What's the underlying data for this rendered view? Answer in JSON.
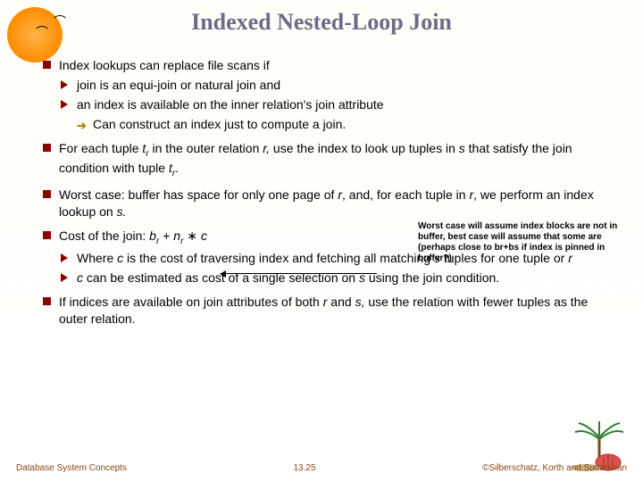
{
  "title": "Indexed Nested-Loop Join",
  "b1_1": "Index lookups can replace file scans if",
  "b2_1": "join is an equi-join or natural join and",
  "b2_2": "an index is available on the inner relation's join attribute",
  "b3_1": "Can construct an index just to compute a join.",
  "b1_2a": "For each tuple ",
  "b1_2_tr": "t",
  "b1_2_r": "r",
  "b1_2b": " in the outer relation ",
  "b1_2_ri": "r,",
  "b1_2c": " use the index to look up tuples in ",
  "b1_2_s": "s",
  "b1_2d": " that satisfy the join condition with tuple ",
  "b1_2e": ".",
  "b1_3a": "Worst case:  buffer has space for only one page of ",
  "b1_3_r": "r",
  "b1_3b": ", and, for each tuple in ",
  "b1_3_r2": "r",
  "b1_3c": ", we perform an index lookup on ",
  "b1_3_s": "s.",
  "b1_4a": "Cost of the join:  ",
  "b1_4_br": "b",
  "b1_4_brs": "r",
  "b1_4b": "  + ",
  "b1_4_nr": "n",
  "b1_4_nrs": "r",
  "b1_4c": " ∗ ",
  "b1_4_c": "c",
  "b2_3a": "Where ",
  "b2_3_c": "c",
  "b2_3b": " is the cost of traversing index and fetching all matching ",
  "b2_3_s": "s",
  "b2_3c": " tuples for one tuple or ",
  "b2_3_r": "r",
  "b2_4a": "",
  "b2_4_c": "c",
  "b2_4b": " can be estimated as cost of a single selection on ",
  "b2_4_s": "s",
  "b2_4c": " using the join condition.",
  "b1_5a": "If indices are available on join attributes of both ",
  "b1_5_r": "r",
  "b1_5b": " and ",
  "b1_5_s": "s,",
  "b1_5c": " use the relation with fewer tuples as the outer relation.",
  "note": "Worst case will assume index blocks are not in buffer, best case will assume that some are (perhaps close to br+bs if index is pinned in buffer?)",
  "f1": "Database System Concepts",
  "f2": "13.25",
  "f3": "©Silberschatz, Korth and Sudarshan"
}
